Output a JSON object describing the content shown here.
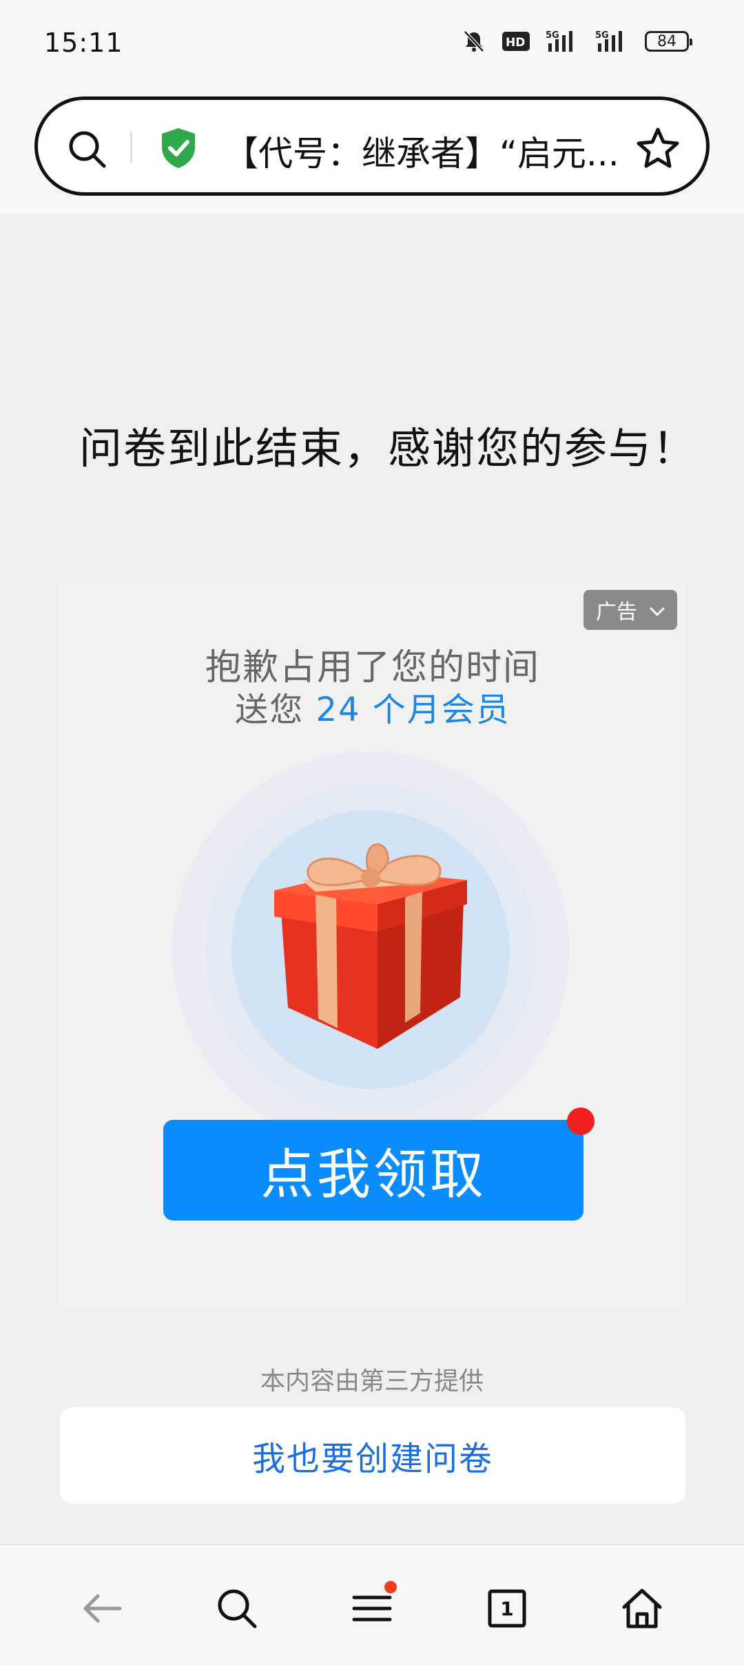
{
  "status_bar": {
    "time": "15:11",
    "icons": [
      "bell-muted-icon",
      "hd-icon",
      "signal-5g-icon",
      "signal-5g-icon"
    ],
    "battery": "84"
  },
  "url_bar": {
    "title": "【代号：继承者】“启元...",
    "icons": [
      "search-icon",
      "shield-check-icon",
      "star-icon"
    ],
    "shield_color": "#2ea84b"
  },
  "main": {
    "end_message": "问卷到此结束，感谢您的参与！"
  },
  "ad": {
    "badge_label": "广告",
    "line1": "抱歉占用了您的时间",
    "line2_prefix": "送您 ",
    "line2_highlight": "24 个月会员",
    "button_label": "点我领取",
    "highlight_color": "#1a86e6",
    "button_color": "#0a8cff"
  },
  "footer": {
    "third_party_note": "本内容由第三方提供",
    "create_button": "我也要创建问卷"
  },
  "bottom_nav": {
    "items": [
      "back-arrow-icon",
      "search-icon",
      "menu-icon",
      "tabs-icon",
      "home-icon"
    ],
    "tab_count": "1"
  }
}
